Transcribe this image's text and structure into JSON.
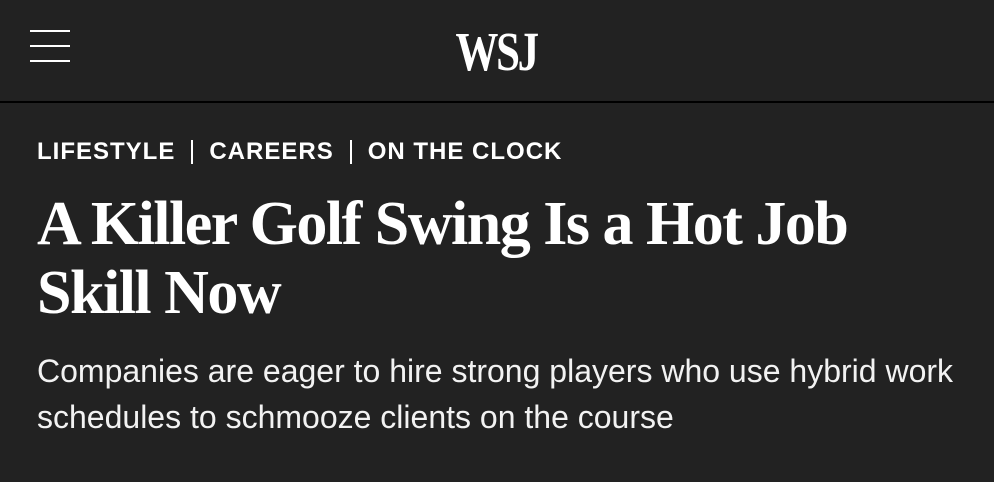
{
  "header": {
    "logo_text": "WSJ",
    "menu_icon": "hamburger-menu-icon"
  },
  "breadcrumb": [
    {
      "label": "LIFESTYLE"
    },
    {
      "label": "CAREERS"
    },
    {
      "label": "ON THE CLOCK"
    }
  ],
  "article": {
    "headline": "A Killer Golf Swing Is a Hot Job Skill Now",
    "subhead": "Companies are eager to hire strong players who use hybrid work schedules to schmooze clients on the course"
  },
  "colors": {
    "background": "#222222",
    "text": "#ffffff",
    "divider": "#000000"
  }
}
